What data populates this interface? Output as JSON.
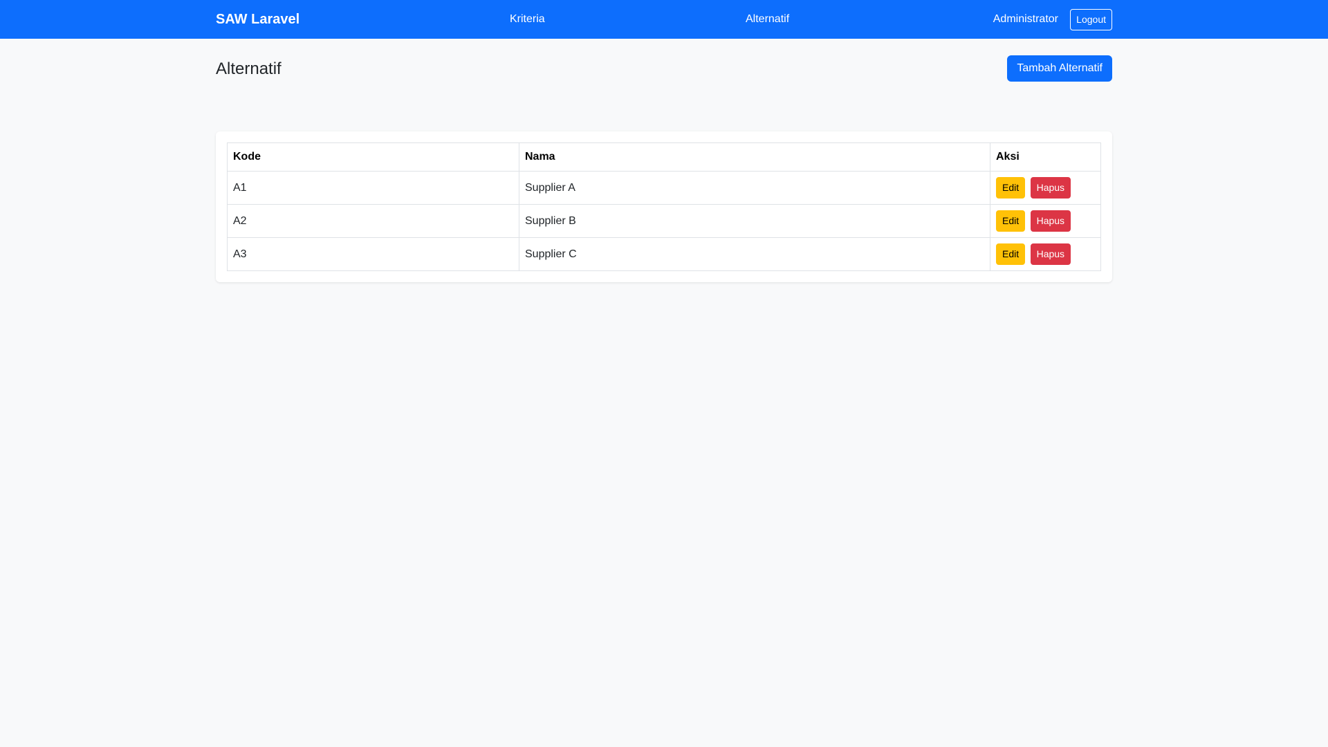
{
  "navbar": {
    "brand": "SAW Laravel",
    "links": [
      {
        "label": "Kriteria"
      },
      {
        "label": "Alternatif"
      }
    ],
    "user": "Administrator",
    "logout_label": "Logout"
  },
  "page": {
    "title": "Alternatif",
    "add_button_label": "Tambah Alternatif"
  },
  "table": {
    "headers": [
      "Kode",
      "Nama",
      "Aksi"
    ],
    "rows": [
      {
        "kode": "A1",
        "nama": "Supplier A"
      },
      {
        "kode": "A2",
        "nama": "Supplier B"
      },
      {
        "kode": "A3",
        "nama": "Supplier C"
      }
    ],
    "edit_label": "Edit",
    "delete_label": "Hapus"
  },
  "colors": {
    "primary": "#0d6efd",
    "warning": "#ffc107",
    "danger": "#dc3545",
    "background": "#f8f9fa"
  }
}
